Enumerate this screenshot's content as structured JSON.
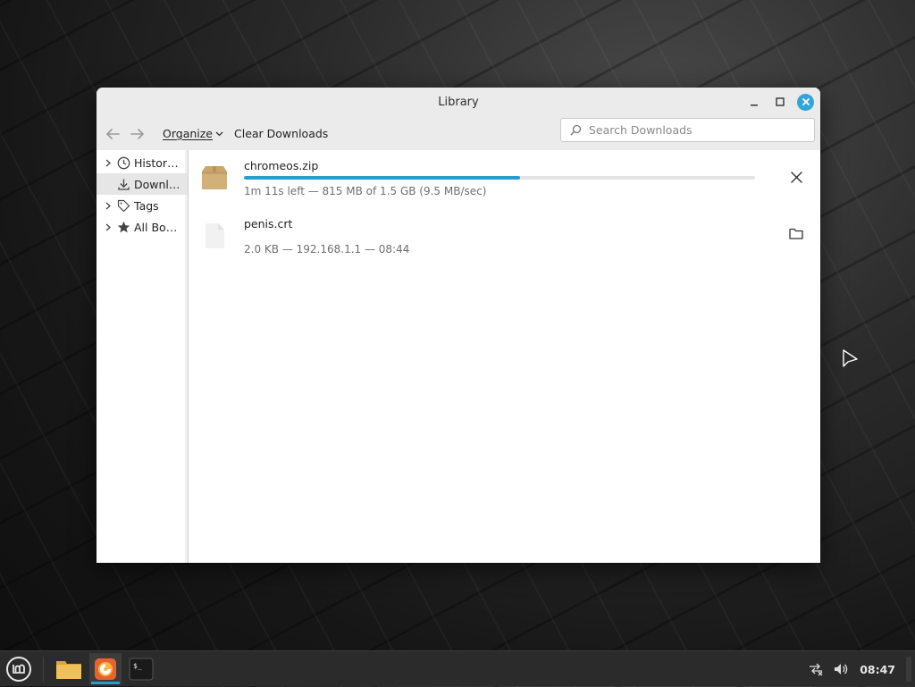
{
  "window": {
    "title": "Library"
  },
  "toolbar": {
    "organize_label": "Organize",
    "clear_label": "Clear Downloads",
    "search_placeholder": "Search Downloads"
  },
  "sidebar": {
    "items": [
      {
        "label": "Histor…",
        "icon": "clock-icon",
        "expandable": true
      },
      {
        "label": "Downl…",
        "icon": "download-icon",
        "expandable": false,
        "selected": true
      },
      {
        "label": "Tags",
        "icon": "tag-icon",
        "expandable": true
      },
      {
        "label": "All Bo…",
        "icon": "star-icon",
        "expandable": true
      }
    ]
  },
  "downloads": [
    {
      "name": "chromeos.zip",
      "status": "1m 11s left — 815 MB of 1.5 GB (9.5 MB/sec)",
      "progress": 0.54,
      "icon": "archive-icon",
      "action": "cancel"
    },
    {
      "name": "penis.crt",
      "status": "2.0 KB — 192.168.1.1 — 08:44",
      "icon": "file-icon",
      "action": "open-folder"
    }
  ],
  "taskbar": {
    "clock": "08:47",
    "launchers": [
      "files",
      "firefox",
      "terminal"
    ]
  },
  "colors": {
    "accent": "#2a9dcf",
    "close": "#35a4d8",
    "titlebar": "#ebebeb"
  }
}
